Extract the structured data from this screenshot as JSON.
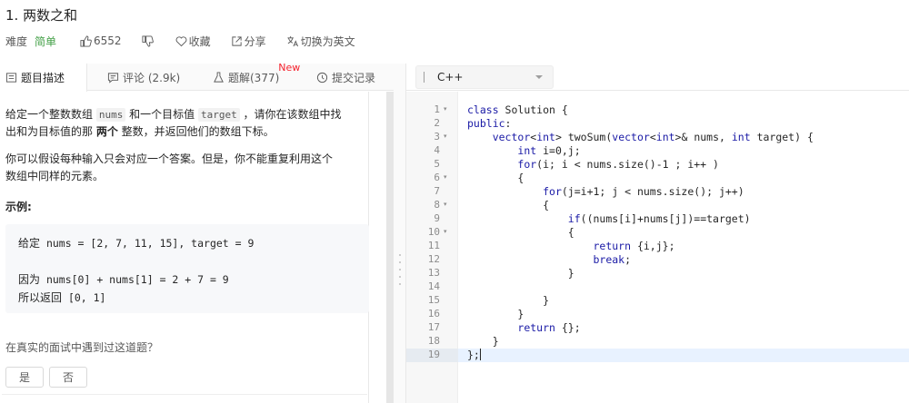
{
  "header": {
    "title": "1. 两数之和",
    "difficulty_label": "难度",
    "difficulty": "简单",
    "likes": "6552",
    "favorite": "收藏",
    "share": "分享",
    "switch_lang": "切换为英文"
  },
  "tabs": [
    {
      "label": "题目描述",
      "active": true
    },
    {
      "label": "评论 (2.9k)",
      "active": false
    },
    {
      "label": "题解(377)",
      "badge": "New",
      "active": false
    },
    {
      "label": "提交记录",
      "active": false
    }
  ],
  "problem": {
    "p1_a": "给定一个整数数组 ",
    "p1_nums": "nums",
    "p1_b": " 和一个目标值 ",
    "p1_target": "target",
    "p1_c": " ，请你在该数组中找",
    "p1_d": "出和为目标值的那 ",
    "p1_bold": "两个",
    "p1_e": " 整数，并返回他们的数组下标。",
    "p2_a": "你可以假设每种输入只会对应一个答案。但是，你不能重复利用这个",
    "p2_b": "数组中同样的元素。",
    "example_title": "示例:",
    "ex1_cn": "给定",
    "ex1_code": " nums = [2, 7, 11, 15], target = 9",
    "ex2_cn": "因为",
    "ex2_code": " nums[0] + nums[1] = 2 + 7 = 9",
    "ex3_cn": "所以返回",
    "ex3_code": " [0, 1]",
    "question": "在真实的面试中遇到过这道题？",
    "yes": "是",
    "no": "否"
  },
  "editor": {
    "language": "C++",
    "line_numbers": [
      "1",
      "2",
      "3",
      "4",
      "5",
      "6",
      "7",
      "8",
      "9",
      "10",
      "11",
      "12",
      "13",
      "14",
      "15",
      "16",
      "17",
      "18",
      "19"
    ],
    "lines": [
      "class Solution {",
      "public:",
      "    vector<int> twoSum(vector<int>& nums, int target) {",
      "        int i=0,j;",
      "        for(i; i < nums.size()-1 ; i++ )",
      "        {",
      "            for(j=i+1; j < nums.size(); j++)",
      "            {",
      "                if((nums[i]+nums[j])==target)",
      "                {",
      "                    return {i,j};",
      "                    break;",
      "                }",
      "",
      "            }",
      "        }",
      "        return {};",
      "    }",
      "};"
    ]
  },
  "colors": {
    "difficulty_easy": "#43a047",
    "new_badge": "#f5222d",
    "keyword": "#1a1aa6",
    "active_line": "#e8f2ff"
  }
}
